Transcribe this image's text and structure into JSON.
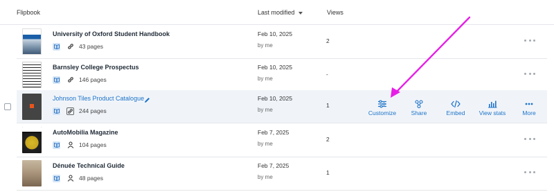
{
  "header": {
    "flipbook": "Flipbook",
    "last_modified": "Last modified",
    "views": "Views"
  },
  "rows": [
    {
      "title": "University of Oxford Student Handbook",
      "pages": "43 pages",
      "date": "Feb 10, 2025",
      "by": "by me",
      "views": "2",
      "share_icon": "link-icon"
    },
    {
      "title": "Barnsley College Prospectus",
      "pages": "146 pages",
      "date": "Feb 10, 2025",
      "by": "by me",
      "views": "-",
      "share_icon": "link-icon"
    },
    {
      "title": "Johnson Tiles Product Catalogue",
      "pages": "244 pages",
      "date": "Feb 10, 2025",
      "by": "by me",
      "views": "1",
      "share_icon": "link-icon",
      "active": true
    },
    {
      "title": "AutoMobilia Magazine",
      "pages": "104 pages",
      "date": "Feb 7, 2025",
      "by": "by me",
      "views": "2",
      "share_icon": "person-icon"
    },
    {
      "title": "Dénuée Technical Guide",
      "pages": "48 pages",
      "date": "Feb 7, 2025",
      "by": "by me",
      "views": "1",
      "share_icon": "person-icon"
    }
  ],
  "actions": {
    "customize": "Customize",
    "share": "Share",
    "embed": "Embed",
    "view_stats": "View stats",
    "more": "More"
  },
  "colors": {
    "accent": "#1e73c8",
    "annotation_arrow": "#e61ee6"
  }
}
